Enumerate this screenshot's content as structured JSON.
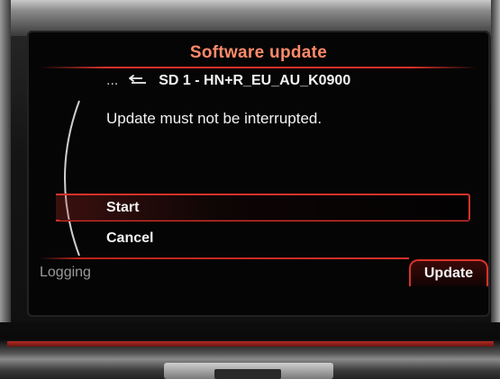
{
  "header": {
    "title": "Software update"
  },
  "path": {
    "ellipsis": "...",
    "label": "SD 1 - HN+R_EU_AU_K0900"
  },
  "message": "Update must not be interrupted.",
  "options": [
    {
      "label": "Start",
      "selected": true
    },
    {
      "label": "Cancel",
      "selected": false
    }
  ],
  "footer": {
    "left_tab": "Logging",
    "right_tab": "Update"
  },
  "colors": {
    "accent": "#d8322a",
    "title": "#ff8a6a",
    "text": "#f2f2f2",
    "muted": "#9a9a9a"
  },
  "icons": {
    "back": "back-arrow-icon"
  }
}
